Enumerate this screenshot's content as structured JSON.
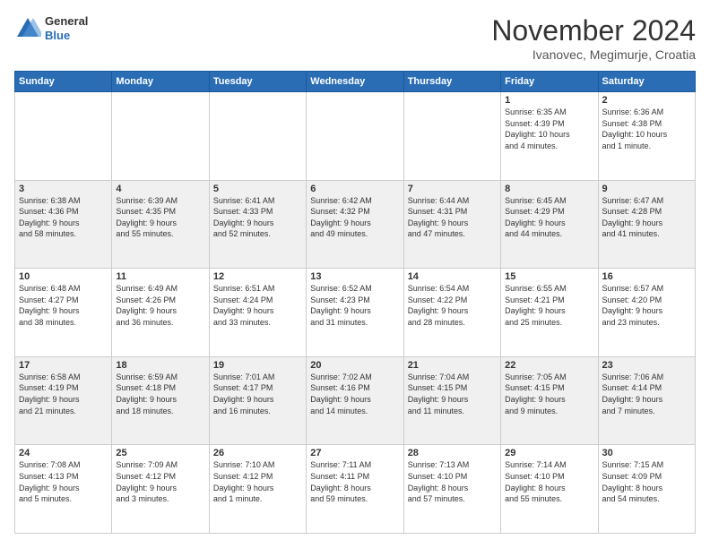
{
  "logo": {
    "general": "General",
    "blue": "Blue"
  },
  "header": {
    "title": "November 2024",
    "location": "Ivanovec, Megimurje, Croatia"
  },
  "days_header": [
    "Sunday",
    "Monday",
    "Tuesday",
    "Wednesday",
    "Thursday",
    "Friday",
    "Saturday"
  ],
  "weeks": [
    [
      {
        "day": "",
        "detail": ""
      },
      {
        "day": "",
        "detail": ""
      },
      {
        "day": "",
        "detail": ""
      },
      {
        "day": "",
        "detail": ""
      },
      {
        "day": "",
        "detail": ""
      },
      {
        "day": "1",
        "detail": "Sunrise: 6:35 AM\nSunset: 4:39 PM\nDaylight: 10 hours\nand 4 minutes."
      },
      {
        "day": "2",
        "detail": "Sunrise: 6:36 AM\nSunset: 4:38 PM\nDaylight: 10 hours\nand 1 minute."
      }
    ],
    [
      {
        "day": "3",
        "detail": "Sunrise: 6:38 AM\nSunset: 4:36 PM\nDaylight: 9 hours\nand 58 minutes."
      },
      {
        "day": "4",
        "detail": "Sunrise: 6:39 AM\nSunset: 4:35 PM\nDaylight: 9 hours\nand 55 minutes."
      },
      {
        "day": "5",
        "detail": "Sunrise: 6:41 AM\nSunset: 4:33 PM\nDaylight: 9 hours\nand 52 minutes."
      },
      {
        "day": "6",
        "detail": "Sunrise: 6:42 AM\nSunset: 4:32 PM\nDaylight: 9 hours\nand 49 minutes."
      },
      {
        "day": "7",
        "detail": "Sunrise: 6:44 AM\nSunset: 4:31 PM\nDaylight: 9 hours\nand 47 minutes."
      },
      {
        "day": "8",
        "detail": "Sunrise: 6:45 AM\nSunset: 4:29 PM\nDaylight: 9 hours\nand 44 minutes."
      },
      {
        "day": "9",
        "detail": "Sunrise: 6:47 AM\nSunset: 4:28 PM\nDaylight: 9 hours\nand 41 minutes."
      }
    ],
    [
      {
        "day": "10",
        "detail": "Sunrise: 6:48 AM\nSunset: 4:27 PM\nDaylight: 9 hours\nand 38 minutes."
      },
      {
        "day": "11",
        "detail": "Sunrise: 6:49 AM\nSunset: 4:26 PM\nDaylight: 9 hours\nand 36 minutes."
      },
      {
        "day": "12",
        "detail": "Sunrise: 6:51 AM\nSunset: 4:24 PM\nDaylight: 9 hours\nand 33 minutes."
      },
      {
        "day": "13",
        "detail": "Sunrise: 6:52 AM\nSunset: 4:23 PM\nDaylight: 9 hours\nand 31 minutes."
      },
      {
        "day": "14",
        "detail": "Sunrise: 6:54 AM\nSunset: 4:22 PM\nDaylight: 9 hours\nand 28 minutes."
      },
      {
        "day": "15",
        "detail": "Sunrise: 6:55 AM\nSunset: 4:21 PM\nDaylight: 9 hours\nand 25 minutes."
      },
      {
        "day": "16",
        "detail": "Sunrise: 6:57 AM\nSunset: 4:20 PM\nDaylight: 9 hours\nand 23 minutes."
      }
    ],
    [
      {
        "day": "17",
        "detail": "Sunrise: 6:58 AM\nSunset: 4:19 PM\nDaylight: 9 hours\nand 21 minutes."
      },
      {
        "day": "18",
        "detail": "Sunrise: 6:59 AM\nSunset: 4:18 PM\nDaylight: 9 hours\nand 18 minutes."
      },
      {
        "day": "19",
        "detail": "Sunrise: 7:01 AM\nSunset: 4:17 PM\nDaylight: 9 hours\nand 16 minutes."
      },
      {
        "day": "20",
        "detail": "Sunrise: 7:02 AM\nSunset: 4:16 PM\nDaylight: 9 hours\nand 14 minutes."
      },
      {
        "day": "21",
        "detail": "Sunrise: 7:04 AM\nSunset: 4:15 PM\nDaylight: 9 hours\nand 11 minutes."
      },
      {
        "day": "22",
        "detail": "Sunrise: 7:05 AM\nSunset: 4:15 PM\nDaylight: 9 hours\nand 9 minutes."
      },
      {
        "day": "23",
        "detail": "Sunrise: 7:06 AM\nSunset: 4:14 PM\nDaylight: 9 hours\nand 7 minutes."
      }
    ],
    [
      {
        "day": "24",
        "detail": "Sunrise: 7:08 AM\nSunset: 4:13 PM\nDaylight: 9 hours\nand 5 minutes."
      },
      {
        "day": "25",
        "detail": "Sunrise: 7:09 AM\nSunset: 4:12 PM\nDaylight: 9 hours\nand 3 minutes."
      },
      {
        "day": "26",
        "detail": "Sunrise: 7:10 AM\nSunset: 4:12 PM\nDaylight: 9 hours\nand 1 minute."
      },
      {
        "day": "27",
        "detail": "Sunrise: 7:11 AM\nSunset: 4:11 PM\nDaylight: 8 hours\nand 59 minutes."
      },
      {
        "day": "28",
        "detail": "Sunrise: 7:13 AM\nSunset: 4:10 PM\nDaylight: 8 hours\nand 57 minutes."
      },
      {
        "day": "29",
        "detail": "Sunrise: 7:14 AM\nSunset: 4:10 PM\nDaylight: 8 hours\nand 55 minutes."
      },
      {
        "day": "30",
        "detail": "Sunrise: 7:15 AM\nSunset: 4:09 PM\nDaylight: 8 hours\nand 54 minutes."
      }
    ]
  ]
}
